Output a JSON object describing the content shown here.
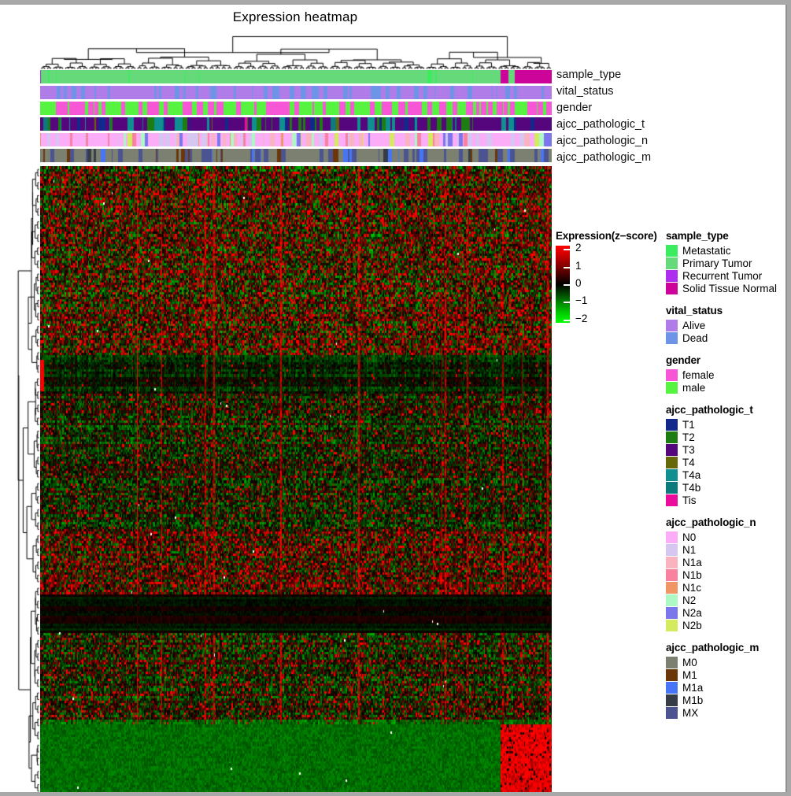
{
  "title": "Expression heatmap",
  "annotation_tracks": [
    {
      "name": "sample_type"
    },
    {
      "name": "vital_status"
    },
    {
      "name": "gender"
    },
    {
      "name": "ajcc_pathologic_t"
    },
    {
      "name": "ajcc_pathologic_n"
    },
    {
      "name": "ajcc_pathologic_m"
    }
  ],
  "color_scale": {
    "title": "Expression(z−score)",
    "ticks": [
      "2",
      "1",
      "0",
      "−1",
      "−2"
    ],
    "tick_values": [
      2,
      1,
      0,
      -1,
      -2
    ],
    "high_color": "#ff0000",
    "mid_color": "#000000",
    "low_color": "#00ff00"
  },
  "legends": [
    {
      "title": "sample_type",
      "items": [
        {
          "label": "Metastatic",
          "color": "#3cec5f"
        },
        {
          "label": "Primary Tumor",
          "color": "#66d97a"
        },
        {
          "label": "Recurrent Tumor",
          "color": "#ae2ef0"
        },
        {
          "label": "Solid Tissue Normal",
          "color": "#cc0499"
        }
      ]
    },
    {
      "title": "vital_status",
      "items": [
        {
          "label": "Alive",
          "color": "#b07ce8"
        },
        {
          "label": "Dead",
          "color": "#6e94e8"
        }
      ]
    },
    {
      "title": "gender",
      "items": [
        {
          "label": "female",
          "color": "#f757d6"
        },
        {
          "label": "male",
          "color": "#56f441"
        }
      ]
    },
    {
      "title": "ajcc_pathologic_t",
      "items": [
        {
          "label": "T1",
          "color": "#12298c"
        },
        {
          "label": "T2",
          "color": "#1d7d12"
        },
        {
          "label": "T3",
          "color": "#55067c"
        },
        {
          "label": "T4",
          "color": "#66690a"
        },
        {
          "label": "T4a",
          "color": "#0f8f8f"
        },
        {
          "label": "T4b",
          "color": "#0d7a7d"
        },
        {
          "label": "Tis",
          "color": "#ec0c9b"
        }
      ]
    },
    {
      "title": "ajcc_pathologic_n",
      "items": [
        {
          "label": "N0",
          "color": "#fbadf7"
        },
        {
          "label": "N1",
          "color": "#d6c6f2"
        },
        {
          "label": "N1a",
          "color": "#f9b4c0"
        },
        {
          "label": "N1b",
          "color": "#f9819f"
        },
        {
          "label": "N1c",
          "color": "#ef9664"
        },
        {
          "label": "N2",
          "color": "#adf9c4"
        },
        {
          "label": "N2a",
          "color": "#7b76ec"
        },
        {
          "label": "N2b",
          "color": "#d5eb5f"
        }
      ]
    },
    {
      "title": "ajcc_pathologic_m",
      "items": [
        {
          "label": "M0",
          "color": "#7b8070"
        },
        {
          "label": "M1",
          "color": "#6b3708"
        },
        {
          "label": "M1a",
          "color": "#4874f7"
        },
        {
          "label": "M1b",
          "color": "#373d47"
        },
        {
          "label": "MX",
          "color": "#4b5490"
        }
      ]
    }
  ],
  "chart_data": {
    "type": "heatmap",
    "title": "Expression heatmap",
    "xlabel": "",
    "ylabel": "",
    "value_label": "Expression(z−score)",
    "zlim": [
      -2,
      2
    ],
    "grid": false,
    "legend_position": "right",
    "n_columns": 420,
    "n_rows": 260,
    "row_clustered": true,
    "column_clustered": true,
    "colormap": [
      "#00ff00",
      "#000000",
      "#ff0000"
    ],
    "column_annotations": {
      "sample_type": {
        "dominant": "Primary Tumor",
        "normal_block_start_fraction": 0.9,
        "values_summary": [
          {
            "label": "Primary Tumor",
            "approx_fraction": 0.88
          },
          {
            "label": "Solid Tissue Normal",
            "approx_fraction": 0.1
          },
          {
            "label": "Metastatic",
            "approx_fraction": 0.015
          },
          {
            "label": "Recurrent Tumor",
            "approx_fraction": 0.005
          }
        ]
      },
      "vital_status": {
        "values_summary": [
          {
            "label": "Alive",
            "approx_fraction": 0.72
          },
          {
            "label": "Dead",
            "approx_fraction": 0.28
          }
        ]
      },
      "gender": {
        "values_summary": [
          {
            "label": "male",
            "approx_fraction": 0.55
          },
          {
            "label": "female",
            "approx_fraction": 0.45
          }
        ]
      },
      "ajcc_pathologic_t": {
        "values_summary": [
          {
            "label": "T3",
            "approx_fraction": 0.58
          },
          {
            "label": "T2",
            "approx_fraction": 0.14
          },
          {
            "label": "T4a",
            "approx_fraction": 0.1
          },
          {
            "label": "T1",
            "approx_fraction": 0.09
          },
          {
            "label": "T4",
            "approx_fraction": 0.05
          },
          {
            "label": "T4b",
            "approx_fraction": 0.03
          },
          {
            "label": "Tis",
            "approx_fraction": 0.01
          }
        ]
      },
      "ajcc_pathologic_n": {
        "values_summary": [
          {
            "label": "N0",
            "approx_fraction": 0.5
          },
          {
            "label": "N1",
            "approx_fraction": 0.16
          },
          {
            "label": "N1a",
            "approx_fraction": 0.09
          },
          {
            "label": "N1b",
            "approx_fraction": 0.07
          },
          {
            "label": "N2a",
            "approx_fraction": 0.06
          },
          {
            "label": "N2",
            "approx_fraction": 0.05
          },
          {
            "label": "N2b",
            "approx_fraction": 0.04
          },
          {
            "label": "N1c",
            "approx_fraction": 0.03
          }
        ]
      },
      "ajcc_pathologic_m": {
        "values_summary": [
          {
            "label": "M0",
            "approx_fraction": 0.62
          },
          {
            "label": "MX",
            "approx_fraction": 0.22
          },
          {
            "label": "M1",
            "approx_fraction": 0.1
          },
          {
            "label": "M1a",
            "approx_fraction": 0.04
          },
          {
            "label": "M1b",
            "approx_fraction": 0.02
          }
        ]
      }
    },
    "row_bands": [
      {
        "from_fraction": 0.0,
        "to_fraction": 0.3,
        "character": "high-variance, many red spikes"
      },
      {
        "from_fraction": 0.3,
        "to_fraction": 0.36,
        "character": "mostly dark with one strong red column"
      },
      {
        "from_fraction": 0.36,
        "to_fraction": 0.58,
        "character": "mixed red/green moderate"
      },
      {
        "from_fraction": 0.58,
        "to_fraction": 0.68,
        "character": "red-enriched rows"
      },
      {
        "from_fraction": 0.68,
        "to_fraction": 0.74,
        "character": "near-zero, uniformly black"
      },
      {
        "from_fraction": 0.74,
        "to_fraction": 0.88,
        "character": "mixed with red streaks"
      },
      {
        "from_fraction": 0.88,
        "to_fraction": 1.0,
        "character": "dark green with bright red block at right (normal samples)"
      }
    ]
  }
}
